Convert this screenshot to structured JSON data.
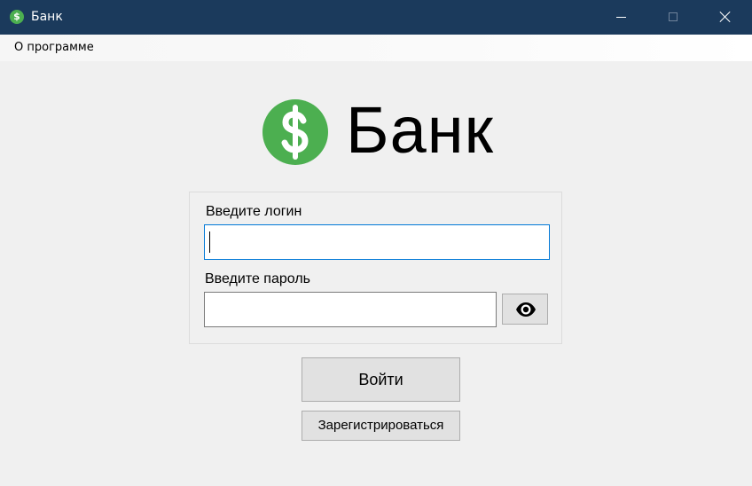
{
  "window": {
    "title": "Банк",
    "app_icon_glyph": "$",
    "controls": [
      "minimize",
      "maximize",
      "close"
    ]
  },
  "menu": {
    "items": [
      "О программе"
    ]
  },
  "logo": {
    "glyph": "$",
    "title": "Банк",
    "color": "#4caf50"
  },
  "form": {
    "login_label": "Введите логин",
    "login_value": "",
    "password_label": "Введите пароль",
    "password_value": "",
    "show_password_icon": "eye-icon"
  },
  "buttons": {
    "login": "Войти",
    "register": "Зарегистрироваться"
  },
  "colors": {
    "titlebar": "#1b3a5c",
    "accent": "#4caf50",
    "focus_border": "#0078d7"
  }
}
